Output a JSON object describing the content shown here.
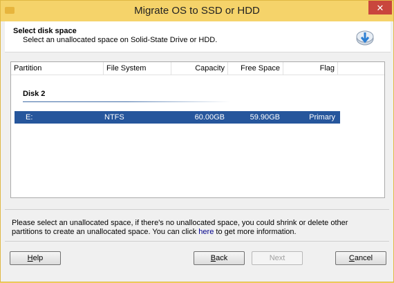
{
  "window": {
    "title": "Migrate OS to SSD or HDD",
    "close_label": "✕"
  },
  "header": {
    "title": "Select disk space",
    "subtitle": "Select an unallocated space on Solid-State Drive or HDD.",
    "icon": "disk-download-icon"
  },
  "list": {
    "columns": [
      "Partition",
      "File System",
      "Capacity",
      "Free Space",
      "Flag"
    ],
    "disk_label": "Disk 2",
    "rows": [
      {
        "partition": "E:",
        "file_system": "NTFS",
        "capacity": "60.00GB",
        "free_space": "59.90GB",
        "flag": "Primary"
      }
    ]
  },
  "info": {
    "text_before": "Please select an unallocated space, if there's no unallocated space, you could shrink or delete other partitions to create an unallocated space. You can click ",
    "link": "here",
    "text_after": " to get more information."
  },
  "buttons": {
    "help": {
      "first": "H",
      "rest": "elp"
    },
    "back": {
      "first": "B",
      "rest": "ack"
    },
    "next": "Next",
    "cancel": {
      "first": "C",
      "rest": "ancel"
    }
  },
  "colors": {
    "titlebar": "#f5d36a",
    "selection": "#26569c",
    "close": "#c9463d"
  }
}
